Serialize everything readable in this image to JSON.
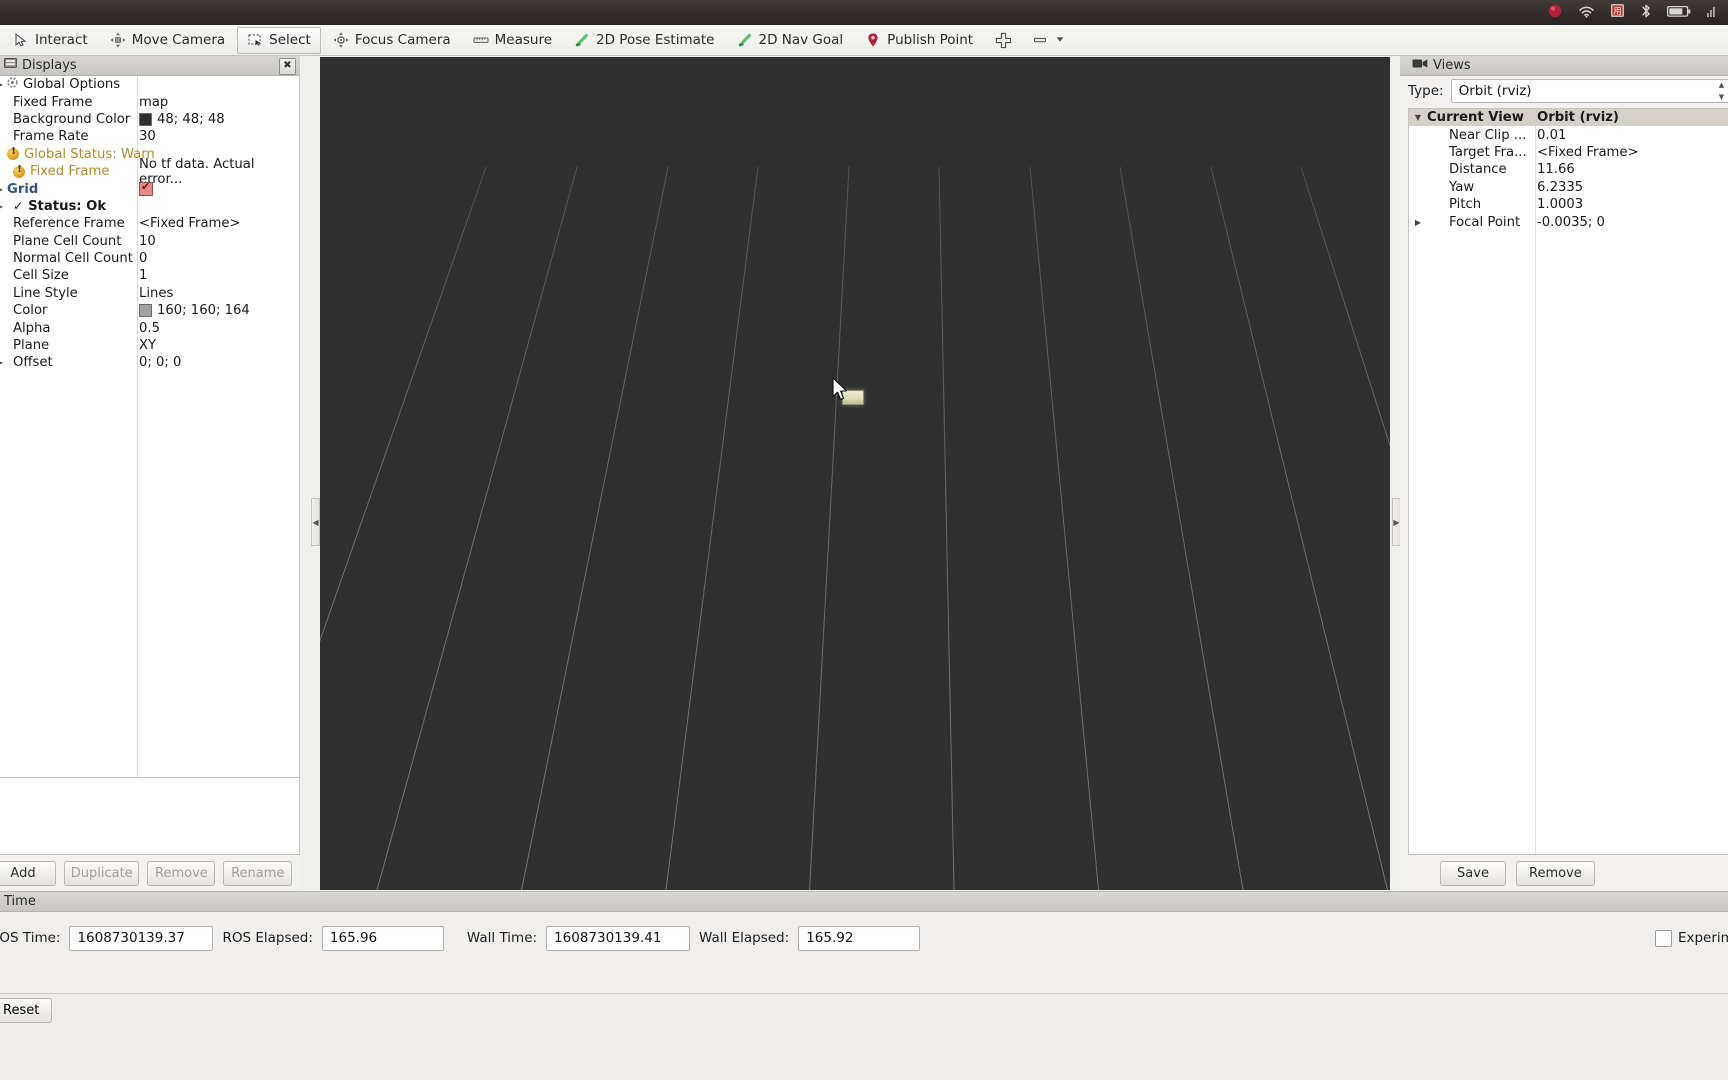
{
  "system_tray": {
    "icons": [
      "record-indicator-icon",
      "wifi-icon",
      "input-method-icon",
      "bluetooth-icon",
      "battery-icon",
      "volume-icon"
    ]
  },
  "toolbar": {
    "tools": [
      {
        "label": "Interact",
        "icon": "interact-icon",
        "active": false
      },
      {
        "label": "Move Camera",
        "icon": "move-camera-icon",
        "active": false
      },
      {
        "label": "Select",
        "icon": "select-icon",
        "active": true
      },
      {
        "label": "Focus Camera",
        "icon": "focus-camera-icon",
        "active": false
      },
      {
        "label": "Measure",
        "icon": "measure-icon",
        "active": false
      },
      {
        "label": "2D Pose Estimate",
        "icon": "pose-estimate-icon",
        "active": false
      },
      {
        "label": "2D Nav Goal",
        "icon": "nav-goal-icon",
        "active": false
      },
      {
        "label": "Publish Point",
        "icon": "publish-point-icon",
        "active": false
      }
    ],
    "add_tool_icon": "plus-icon",
    "remove_tool_icon": "minus-dropdown-icon"
  },
  "displays": {
    "title": "Displays",
    "title_icon": "displays-panel-icon",
    "close_icon": "close-icon",
    "rows": [
      {
        "name": "Global Options",
        "value": "",
        "icon": "global-options-icon",
        "expander": "▶",
        "indent": 0,
        "style": "plain"
      },
      {
        "name": "Fixed Frame",
        "value": "map",
        "expander": "",
        "indent": 1,
        "style": "plain"
      },
      {
        "name": "Background Color",
        "value": "48; 48; 48",
        "expander": "",
        "indent": 1,
        "style": "plain",
        "swatch": "#303030"
      },
      {
        "name": "Frame Rate",
        "value": "30",
        "expander": "",
        "indent": 1,
        "style": "plain"
      },
      {
        "name": "Global Status: Warn",
        "value": "",
        "expander": "",
        "indent": 0,
        "style": "warn",
        "badge": "warn"
      },
      {
        "name": "Fixed Frame",
        "value": "No tf data.  Actual error...",
        "expander": "",
        "indent": 1,
        "style": "warn",
        "badge": "warn"
      },
      {
        "name": "Grid",
        "value": "",
        "expander": "▶",
        "indent": 0,
        "style": "grid",
        "checkbox": true
      },
      {
        "name": "Status: Ok",
        "value": "",
        "expander": "▶",
        "indent": 1,
        "style": "bold",
        "badge": "ok"
      },
      {
        "name": "Reference Frame",
        "value": "<Fixed Frame>",
        "expander": "",
        "indent": 1,
        "style": "plain"
      },
      {
        "name": "Plane Cell Count",
        "value": "10",
        "expander": "",
        "indent": 1,
        "style": "plain"
      },
      {
        "name": "Normal Cell Count",
        "value": "0",
        "expander": "",
        "indent": 1,
        "style": "plain"
      },
      {
        "name": "Cell Size",
        "value": "1",
        "expander": "",
        "indent": 1,
        "style": "plain"
      },
      {
        "name": "Line Style",
        "value": "Lines",
        "expander": "",
        "indent": 1,
        "style": "plain"
      },
      {
        "name": "Color",
        "value": "160; 160; 164",
        "expander": "",
        "indent": 1,
        "style": "plain",
        "swatch": "#a0a0a4"
      },
      {
        "name": "Alpha",
        "value": "0.5",
        "expander": "",
        "indent": 1,
        "style": "plain"
      },
      {
        "name": "Plane",
        "value": "XY",
        "expander": "",
        "indent": 1,
        "style": "plain"
      },
      {
        "name": "Offset",
        "value": "0; 0; 0",
        "expander": "▶",
        "indent": 1,
        "style": "plain"
      }
    ],
    "buttons": [
      {
        "label": "Add",
        "enabled": true
      },
      {
        "label": "Duplicate",
        "enabled": false
      },
      {
        "label": "Remove",
        "enabled": false
      },
      {
        "label": "Rename",
        "enabled": false
      }
    ]
  },
  "views": {
    "title": "Views",
    "title_icon": "views-panel-icon",
    "type_label": "Type:",
    "type_value": "Orbit (rviz)",
    "rows": [
      {
        "name": "Current View",
        "value": "Orbit (rviz)",
        "expander": "▼",
        "selected": true
      },
      {
        "name": "Near Clip ...",
        "value": "0.01",
        "expander": "",
        "selected": false
      },
      {
        "name": "Target Fra...",
        "value": "<Fixed Frame>",
        "expander": "",
        "selected": false
      },
      {
        "name": "Distance",
        "value": "11.66",
        "expander": "",
        "selected": false
      },
      {
        "name": "Yaw",
        "value": "6.2335",
        "expander": "",
        "selected": false
      },
      {
        "name": "Pitch",
        "value": "1.0003",
        "expander": "",
        "selected": false
      },
      {
        "name": "Focal Point",
        "value": "-0.0035; 0",
        "expander": "▶",
        "selected": false
      }
    ],
    "buttons": [
      {
        "label": "Save"
      },
      {
        "label": "Remove"
      }
    ]
  },
  "viewport": {
    "background_color": "#303030",
    "grid_color": "#a0a0a4",
    "robot_marker_name": "robot-marker",
    "cursor_name": "mouse-cursor"
  },
  "time_panel": {
    "title": "Time",
    "fields": [
      {
        "label": "ROS Time:",
        "value": "1608730139.37",
        "width": "wide"
      },
      {
        "label": "ROS Elapsed:",
        "value": "165.96",
        "width": "mid"
      },
      {
        "label": "Wall Time:",
        "value": "1608730139.41",
        "width": "wide"
      },
      {
        "label": "Wall Elapsed:",
        "value": "165.92",
        "width": "mid"
      }
    ],
    "experimental_label": "Experimental",
    "reset_label": "Reset"
  },
  "colors": {
    "panel_bg": "#f2f1ef",
    "titlebar": "#cfcdc9",
    "viewport_bg": "#303030",
    "warn": "#b08a30",
    "grid_blue": "#34567c"
  }
}
